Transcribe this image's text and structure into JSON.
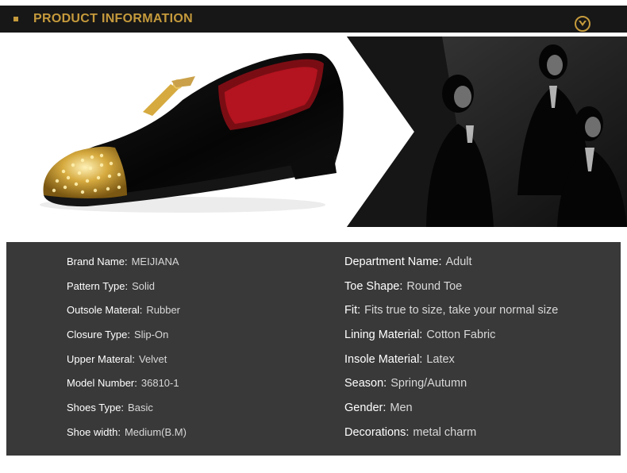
{
  "header": {
    "title": "PRODUCT INFORMATION",
    "icon": "chevron-down-icon",
    "accent_color": "#c59a3c",
    "bar_color": "#171717"
  },
  "photos": {
    "shoe": "velvet-loafer-gold-spiked-toe-photo",
    "models": "men-in-suits-black-white-photo"
  },
  "specs": {
    "left": [
      {
        "label": "Brand Name:",
        "value": "MEIJIANA"
      },
      {
        "label": "Pattern Type:",
        "value": "Solid"
      },
      {
        "label": "Outsole Materal:",
        "value": "Rubber"
      },
      {
        "label": "Closure Type:",
        "value": "Slip-On"
      },
      {
        "label": "Upper Materal:",
        "value": "Velvet"
      },
      {
        "label": "Model Number:",
        "value": "36810-1"
      },
      {
        "label": "Shoes Type:",
        "value": "Basic"
      },
      {
        "label": "Shoe width:",
        "value": "Medium(B.M)"
      }
    ],
    "right": [
      {
        "label": "Department Name:",
        "value": "Adult"
      },
      {
        "label": "Toe Shape:",
        "value": "Round Toe"
      },
      {
        "label": "Fit:",
        "value": "Fits true to size, take your normal size"
      },
      {
        "label": "Lining Material:",
        "value": "Cotton Fabric"
      },
      {
        "label": "Insole Material:",
        "value": "Latex"
      },
      {
        "label": "Season:",
        "value": "Spring/Autumn"
      },
      {
        "label": "Gender:",
        "value": "Men"
      },
      {
        "label": "Decorations:",
        "value": "metal charm"
      }
    ],
    "panel_color": "#393939"
  }
}
